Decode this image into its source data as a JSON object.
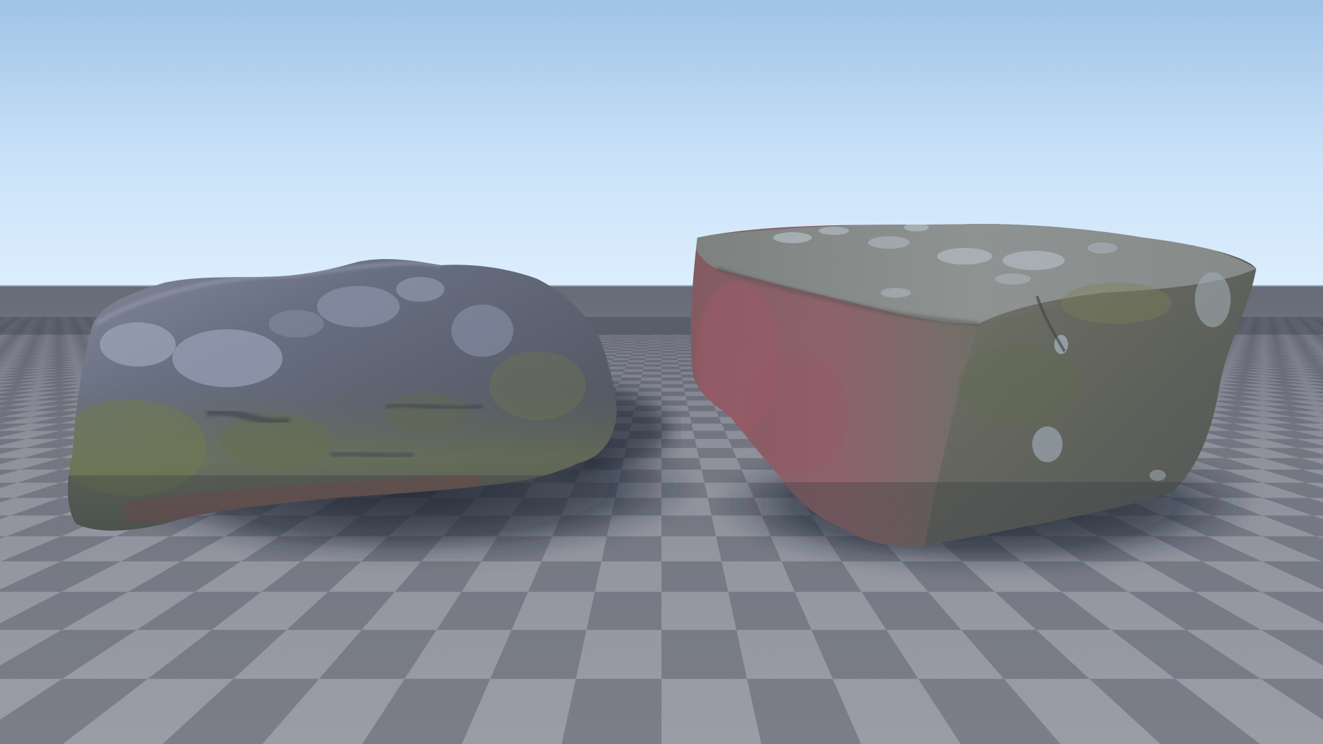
{
  "scene": {
    "sky_colors": {
      "top": "#9fc3e6",
      "mid": "#c9e1f8",
      "horizon": "#dceefe"
    },
    "floor_colors": {
      "light": "#9a9ca6",
      "dark": "#7b7e89",
      "far_light": "#6f737e",
      "far_dark": "#5e626c"
    },
    "shadow_color": "#1a2332",
    "objects": [
      {
        "name": "mossy-boulder",
        "description_colors": [
          "#4d5566",
          "#7d88a8",
          "#6b7a3a",
          "#8f3a3a"
        ]
      },
      {
        "name": "lichen-covered-rock",
        "description_colors": [
          "#55584f",
          "#9aa7b3",
          "#a9485a",
          "#6c7543"
        ]
      }
    ]
  }
}
